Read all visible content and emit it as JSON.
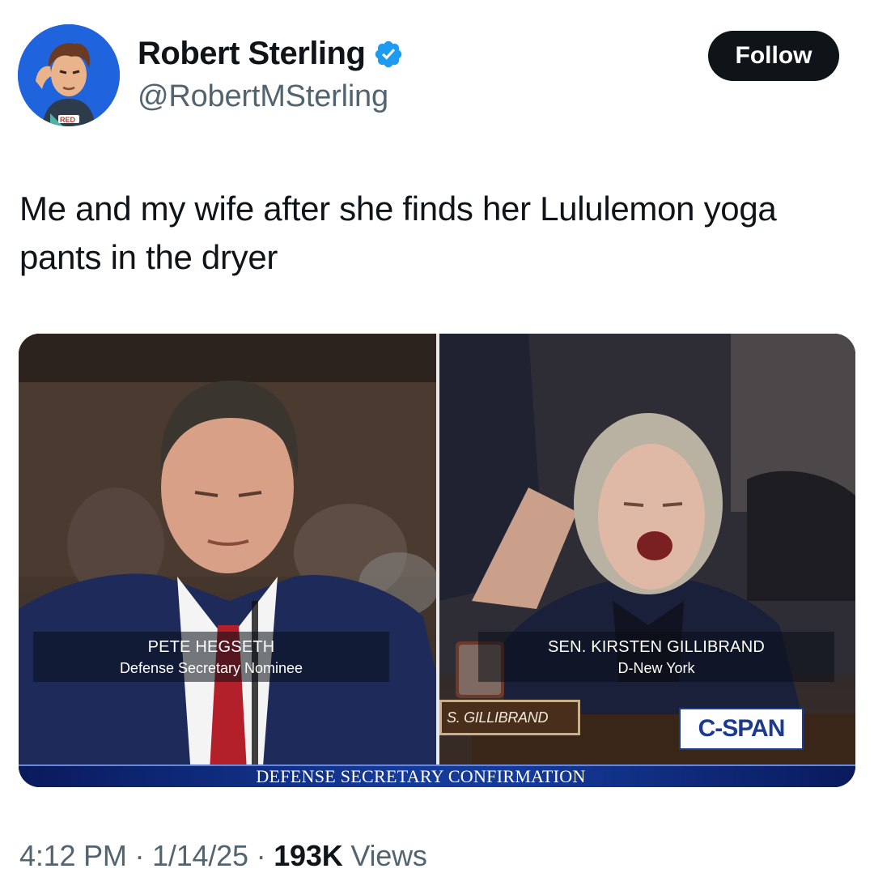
{
  "author": {
    "display_name": "Robert Sterling",
    "handle": "@RobertMSterling",
    "verified_icon": "verified-badge-icon",
    "avatar_icon": "avatar-cartoon-portrait"
  },
  "follow_button": {
    "label": "Follow"
  },
  "tweet": {
    "text": "Me and my wife after she finds her Lululemon yoga pants in the dryer"
  },
  "media": {
    "left_panel": {
      "caption_name": "PETE HEGSETH",
      "caption_title": "Defense Secretary Nominee"
    },
    "right_panel": {
      "caption_name": "SEN. KIRSTEN GILLIBRAND",
      "caption_title": "D-New York",
      "nameplate": "S. GILLIBRAND"
    },
    "network_logo": "C-SPAN",
    "banner": "DEFENSE SECRETARY CONFIRMATION"
  },
  "footer": {
    "time": "4:12 PM",
    "separator": "·",
    "date": "1/14/25",
    "views_count": "193K",
    "views_label": "Views"
  },
  "colors": {
    "text_primary": "#0f1419",
    "text_secondary": "#536471",
    "verified_blue": "#1d9bf0",
    "follow_bg": "#0f1419",
    "cspan_blue": "#1b3b8f"
  }
}
